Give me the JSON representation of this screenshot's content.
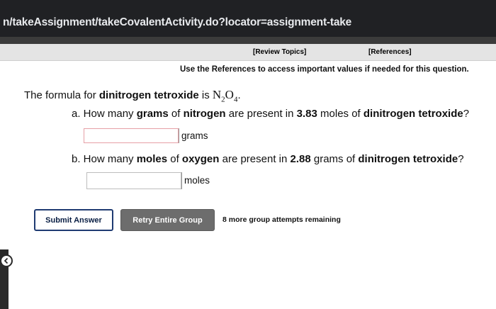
{
  "browser": {
    "url": "n/takeAssignment/takeCovalentActivity.do?locator=assignment-take"
  },
  "header": {
    "review_topics": "[Review Topics]",
    "references": "[References]"
  },
  "instructions": "Use the References to access important values if needed for this question.",
  "intro": {
    "prefix": "The formula for ",
    "compound": "dinitrogen tetroxide",
    "mid": " is ",
    "formula_n": "N",
    "formula_n_sub": "2",
    "formula_o": "O",
    "formula_o_sub": "4",
    "suffix": "."
  },
  "question_a": {
    "lead": "a. How many ",
    "bold1": "grams",
    "t1": " of ",
    "bold2": "nitrogen",
    "t2": " are present in ",
    "bold3": "3.83",
    "t3": " moles of ",
    "bold4": "dinitrogen tetroxide",
    "t4": "?",
    "input_value": "",
    "unit": "grams"
  },
  "question_b": {
    "lead": "b. How many ",
    "bold1": "moles",
    "t1": " of ",
    "bold2": "oxygen",
    "t2": " are present in ",
    "bold3": "2.88",
    "t3": " grams of ",
    "bold4": "dinitrogen tetroxide",
    "t4": "?",
    "input_value": "",
    "unit": "moles"
  },
  "actions": {
    "submit_label": "Submit Answer",
    "retry_label": "Retry Entire Group",
    "attempts_text": "8 more group attempts remaining"
  },
  "icons": {
    "back": "chevron-left-icon"
  },
  "colors": {
    "submit_border": "#1f3b72",
    "retry_bg": "#6d6d6d",
    "invalid_input_border": "#e6a0a6"
  }
}
